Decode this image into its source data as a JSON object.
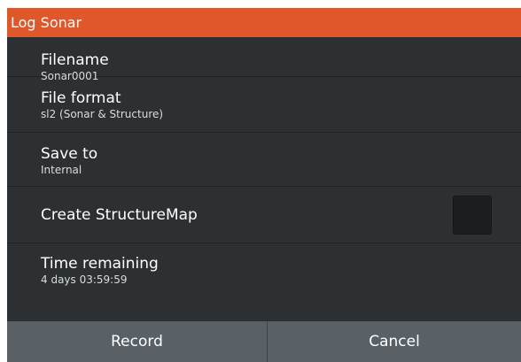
{
  "dialog": {
    "title": "Log Sonar",
    "rows": [
      {
        "label": "Filename",
        "value": "Sonar0001"
      },
      {
        "label": "File format",
        "value": "sl2 (Sonar & Structure)"
      },
      {
        "label": "Save to",
        "value": "Internal"
      },
      {
        "label": "Create StructureMap",
        "checked": false
      },
      {
        "label": "Time remaining",
        "value": "4 days 03:59:59"
      }
    ],
    "buttons": {
      "record": "Record",
      "cancel": "Cancel"
    },
    "colors": {
      "title_bar": "#e0582a",
      "background": "#2c3033",
      "button": "#596066"
    }
  }
}
